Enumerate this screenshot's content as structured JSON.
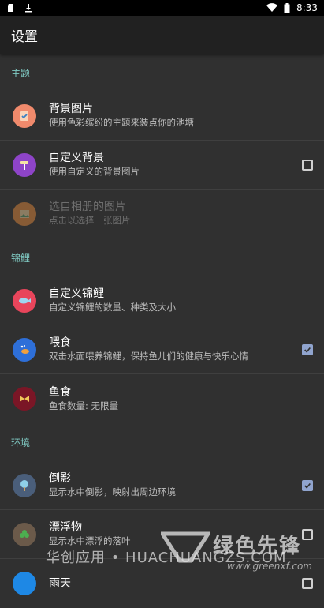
{
  "status_bar": {
    "time": "8:33",
    "icons": [
      "sd-card-icon",
      "download-icon",
      "wifi-icon",
      "battery-icon"
    ]
  },
  "app_bar": {
    "title": "设置"
  },
  "sections": {
    "theme": "主题",
    "koi": "锦鲤",
    "env": "环境"
  },
  "items": {
    "bg_image": {
      "title": "背景图片",
      "subtitle": "使用色彩缤纷的主题来装点你的池塘"
    },
    "custom_bg": {
      "title": "自定义背景",
      "subtitle": "使用自定义的背景图片",
      "checked": false
    },
    "pick_album": {
      "title": "选自相册的图片",
      "subtitle": "点击以选择一张图片"
    },
    "custom_koi": {
      "title": "自定义锦鲤",
      "subtitle": "自定义锦鲤的数量、种类及大小"
    },
    "feed": {
      "title": "喂食",
      "subtitle": "双击水面喂养锦鲤，保持鱼儿们的健康与快乐心情",
      "checked": true
    },
    "fish_food": {
      "title": "鱼食",
      "subtitle": "鱼食数量: 无限量"
    },
    "reflection": {
      "title": "倒影",
      "subtitle": "显示水中倒影，映射出周边环境",
      "checked": true
    },
    "float": {
      "title": "漂浮物",
      "subtitle": "显示水中漂浮的落叶",
      "checked": false
    },
    "rain": {
      "title": "雨天"
    }
  },
  "watermark": {
    "left": "华创应用 • HUACHUANGZS.COM",
    "right": "绿色先锋",
    "url": "www.greenxf.com"
  },
  "colors": {
    "background": "#303030",
    "app_bar": "#212121",
    "section_header": "#80cbc4",
    "checkbox_checked": "#90a4ce"
  }
}
